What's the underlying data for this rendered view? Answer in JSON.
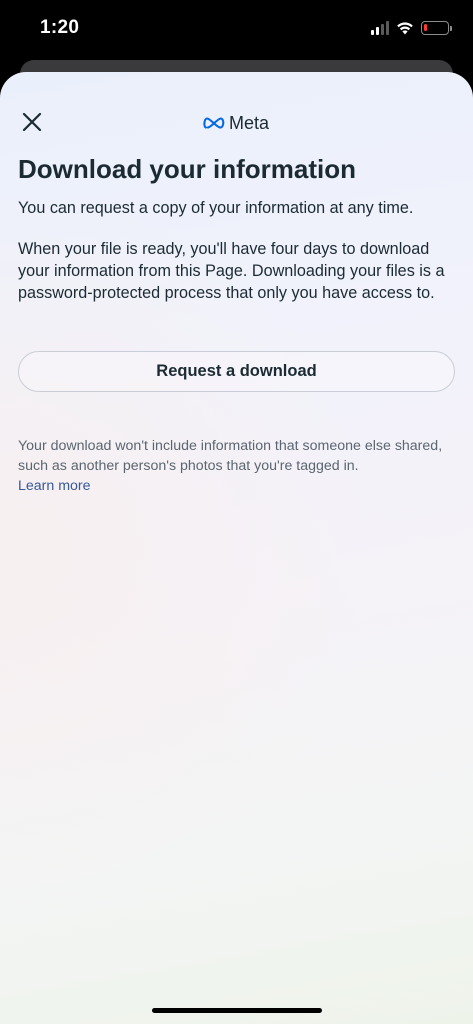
{
  "status_bar": {
    "time": "1:20",
    "signal_bars_active": 2,
    "signal_bars_total": 4,
    "battery_level": 0.12,
    "battery_color": "#ff3b30"
  },
  "header": {
    "close_icon": "close-icon",
    "logo_icon": "meta-infinity-icon",
    "logo_text": "Meta"
  },
  "main": {
    "title": "Download your information",
    "intro": "You can request a copy of your information at any time.",
    "details": "When your file is ready, you'll have four days to download your information from this Page. Downloading your files is a password-protected process that only you have access to.",
    "request_button_label": "Request a download",
    "note": "Your download won't include information that someone else shared, such as another person's photos that you're tagged in.",
    "learn_more_label": "Learn more"
  },
  "colors": {
    "text_primary": "#1c2b33",
    "text_secondary": "#5b6670",
    "link": "#385898",
    "meta_blue": "#0668e1"
  }
}
